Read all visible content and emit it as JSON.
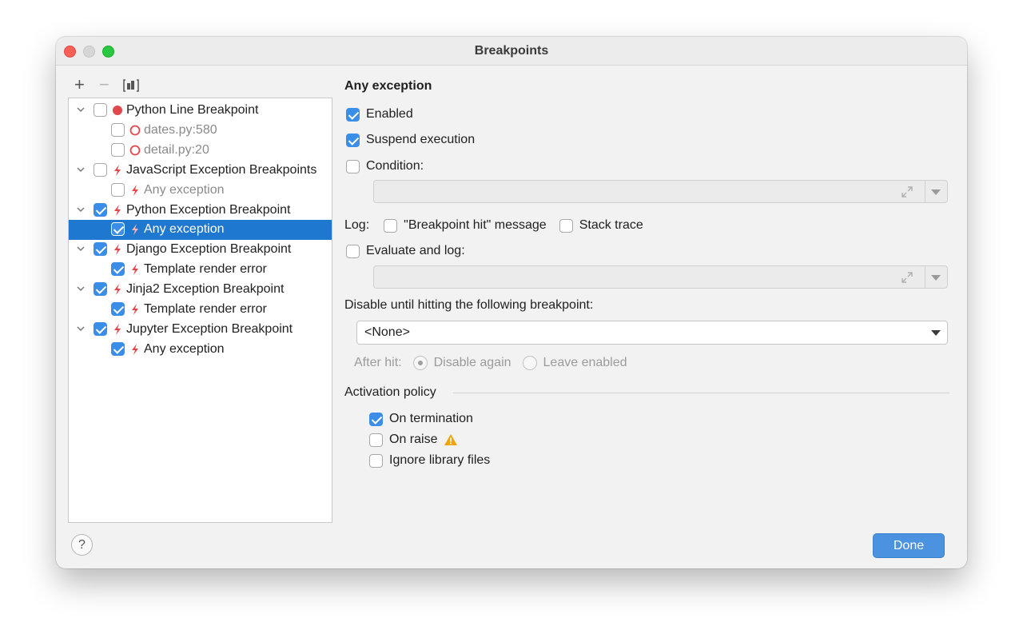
{
  "window": {
    "title": "Breakpoints"
  },
  "toolbar": {
    "add": "+",
    "remove": "−"
  },
  "tree": {
    "rows": [
      {
        "label": "Python Line Breakpoint",
        "checked": false,
        "icon": "red-dot-icon",
        "level": 0,
        "expanded": true
      },
      {
        "label": "dates.py:580",
        "checked": false,
        "icon": "red-circle-icon",
        "level": 1,
        "dim": true
      },
      {
        "label": "detail.py:20",
        "checked": false,
        "icon": "red-circle-icon",
        "level": 1,
        "dim": true
      },
      {
        "label": "JavaScript Exception Breakpoints",
        "checked": false,
        "icon": "lightning-icon",
        "level": 0,
        "expanded": true
      },
      {
        "label": "Any exception",
        "checked": false,
        "icon": "lightning-icon",
        "level": 1,
        "dim": true
      },
      {
        "label": "Python Exception Breakpoint",
        "checked": true,
        "icon": "lightning-icon",
        "level": 0,
        "expanded": true
      },
      {
        "label": "Any exception",
        "checked": true,
        "icon": "lightning-icon",
        "level": 1,
        "selected": true
      },
      {
        "label": "Django Exception Breakpoint",
        "checked": true,
        "icon": "lightning-icon",
        "level": 0,
        "expanded": true
      },
      {
        "label": "Template render error",
        "checked": true,
        "icon": "lightning-icon",
        "level": 1
      },
      {
        "label": "Jinja2 Exception Breakpoint",
        "checked": true,
        "icon": "lightning-icon",
        "level": 0,
        "expanded": true
      },
      {
        "label": "Template render error",
        "checked": true,
        "icon": "lightning-icon",
        "level": 1
      },
      {
        "label": "Jupyter Exception Breakpoint",
        "checked": true,
        "icon": "lightning-icon",
        "level": 0,
        "expanded": true
      },
      {
        "label": "Any exception",
        "checked": true,
        "icon": "lightning-icon",
        "level": 1
      }
    ]
  },
  "panel": {
    "title": "Any exception",
    "enabled": {
      "label": "Enabled",
      "checked": true
    },
    "suspend": {
      "label": "Suspend execution",
      "checked": true
    },
    "condition": {
      "label": "Condition:",
      "checked": false,
      "value": ""
    },
    "log": {
      "label": "Log:",
      "message": {
        "label": "\"Breakpoint hit\" message",
        "checked": false
      },
      "stack": {
        "label": "Stack trace",
        "checked": false
      }
    },
    "evaluate": {
      "label": "Evaluate and log:",
      "checked": false,
      "value": ""
    },
    "disable_until": {
      "label": "Disable until hitting the following breakpoint:",
      "selected": "<None>"
    },
    "after_hit": {
      "label": "After hit:",
      "disable_again": "Disable again",
      "leave_enabled": "Leave enabled",
      "selected": "disable_again"
    },
    "activation": {
      "label": "Activation policy",
      "on_termination": {
        "label": "On termination",
        "checked": true
      },
      "on_raise": {
        "label": "On raise",
        "checked": false,
        "icon": "warning-icon"
      },
      "ignore_library": {
        "label": "Ignore library files",
        "checked": false
      }
    }
  },
  "footer": {
    "help": "?",
    "done": "Done"
  },
  "colors": {
    "accent": "#3b8ee8",
    "selection": "#1f78d0",
    "breakpoint_red": "#e2484b",
    "warning": "#f0a30a"
  }
}
